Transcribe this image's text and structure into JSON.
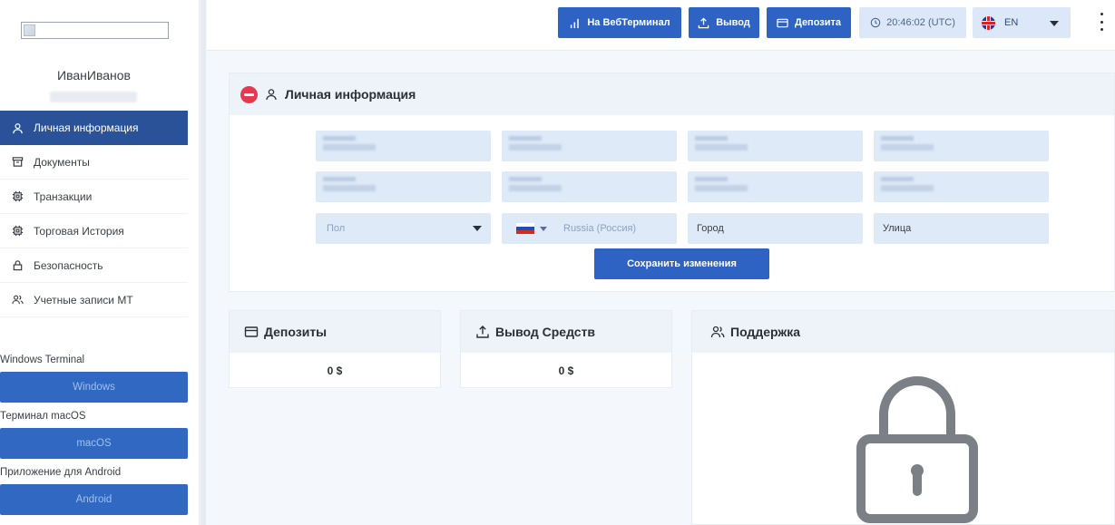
{
  "sidebar": {
    "user_name": "ИванИванов",
    "nav_items": [
      {
        "label": "Личная информация",
        "icon": "user-icon",
        "active": true
      },
      {
        "label": "Документы",
        "icon": "archive-icon",
        "active": false
      },
      {
        "label": "Транзакции",
        "icon": "chip-icon",
        "active": false
      },
      {
        "label": "Торговая История",
        "icon": "chip-icon",
        "active": false
      },
      {
        "label": "Безопасность",
        "icon": "lock-icon",
        "active": false
      },
      {
        "label": "Учетные записи МТ",
        "icon": "users-icon",
        "active": false
      }
    ],
    "downloads": [
      {
        "label": "Windows Terminal",
        "button": "Windows"
      },
      {
        "label": "Терминал macOS",
        "button": "macOS"
      },
      {
        "label": "Приложение для Android",
        "button": "Android"
      }
    ]
  },
  "topbar": {
    "webterminal_label": "На ВебТерминал",
    "withdraw_label": "Вывод",
    "deposit_label": "Депозита",
    "time": "20:46:02 (UTC)",
    "language": "EN"
  },
  "personal_info": {
    "title": "Личная информация",
    "gender_placeholder": "Пол",
    "country_value": "Russia (Россия)",
    "city_placeholder": "Город",
    "street_placeholder": "Улица",
    "save_label": "Сохранить изменения"
  },
  "deposits": {
    "title": "Депозиты",
    "value": "0 $"
  },
  "withdrawals": {
    "title": "Вывод Средств",
    "value": "0 $"
  },
  "support": {
    "title": "Поддержка"
  },
  "colors": {
    "primary": "#2e63c4",
    "sidebar_active": "#2a5298",
    "field_bg": "#dfeaf8",
    "danger": "#e53950"
  }
}
